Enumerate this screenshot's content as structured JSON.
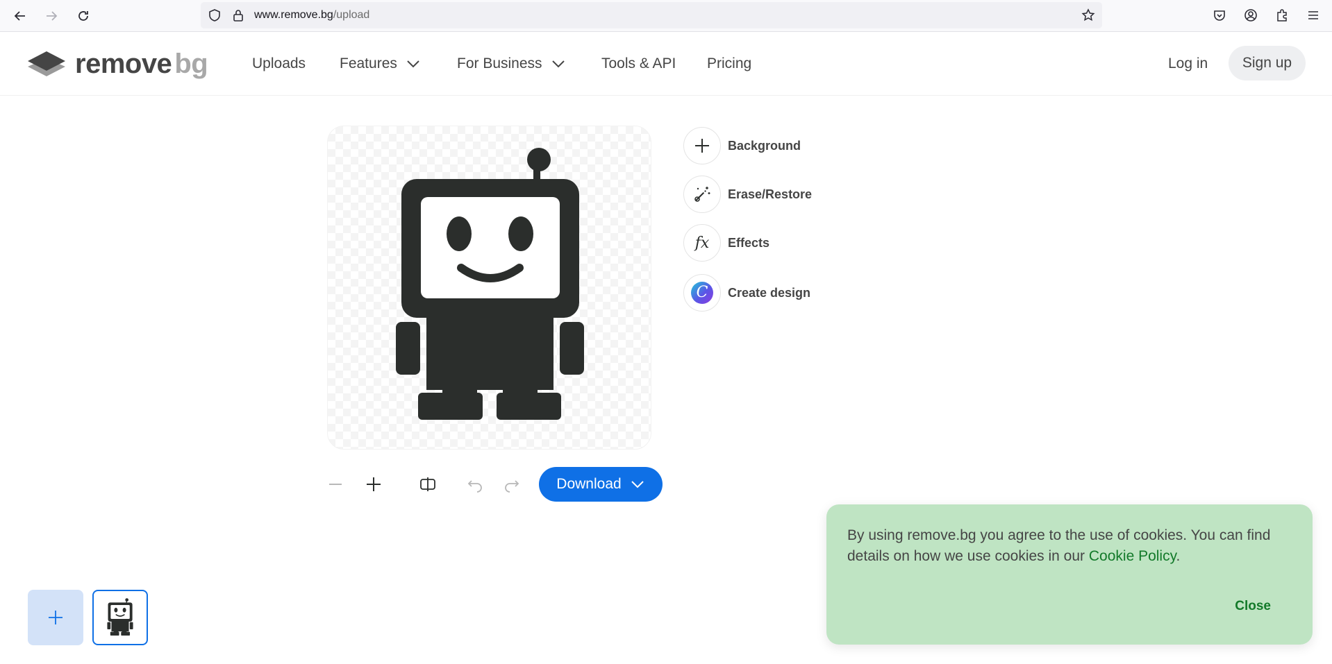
{
  "browser": {
    "url_host": "www.remove.bg",
    "url_path": "/upload"
  },
  "header": {
    "logo_word1": "remove",
    "logo_word2": "bg",
    "nav": [
      {
        "label": "Uploads"
      },
      {
        "label": "Features"
      },
      {
        "label": "For Business"
      },
      {
        "label": "Tools & API"
      },
      {
        "label": "Pricing"
      }
    ],
    "login_label": "Log in",
    "signup_label": "Sign up"
  },
  "editor": {
    "side_tools": [
      {
        "label": "Background",
        "icon": "plus-icon"
      },
      {
        "label": "Erase/Restore",
        "icon": "magic-brush-icon"
      },
      {
        "label": "Effects",
        "icon": "fx-icon"
      },
      {
        "label": "Create design",
        "icon": "canva-icon"
      }
    ],
    "download_label": "Download",
    "effects_icon_text": "fx",
    "canva_icon_text": "C"
  },
  "cookie": {
    "text_before": "By using remove.bg you agree to the use of cookies. You can find details on how we use cookies in our ",
    "link_text": "Cookie Policy",
    "text_after": ".",
    "close_label": "Close"
  },
  "colors": {
    "accent": "#0f70e6",
    "cookie_bg": "#bfe4c3",
    "cookie_link": "#137a2a",
    "robot": "#2b2e2c"
  }
}
